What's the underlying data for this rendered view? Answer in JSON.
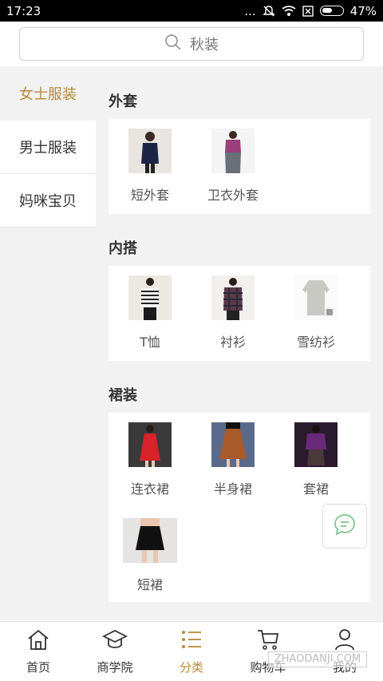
{
  "status_bar": {
    "time": "17:23",
    "dots": "...",
    "battery_pct": "47%"
  },
  "search": {
    "placeholder": "秋装"
  },
  "sidebar": {
    "items": [
      {
        "label": "女士服装",
        "active": true
      },
      {
        "label": "男士服装",
        "active": false
      },
      {
        "label": "妈咪宝贝",
        "active": false
      }
    ]
  },
  "sections": [
    {
      "title": "外套",
      "items": [
        {
          "label": "短外套"
        },
        {
          "label": "卫衣外套"
        }
      ]
    },
    {
      "title": "内搭",
      "items": [
        {
          "label": "T恤"
        },
        {
          "label": "衬衫"
        },
        {
          "label": "雪纺衫"
        }
      ]
    },
    {
      "title": "裙装",
      "items": [
        {
          "label": "连衣裙"
        },
        {
          "label": "半身裙"
        },
        {
          "label": "套裙"
        },
        {
          "label": "短裙"
        }
      ]
    }
  ],
  "tabbar": {
    "items": [
      {
        "label": "首页",
        "icon": "home-icon"
      },
      {
        "label": "商学院",
        "icon": "graduation-cap-icon"
      },
      {
        "label": "分类",
        "icon": "category-list-icon",
        "active": true
      },
      {
        "label": "购物车",
        "icon": "cart-icon"
      },
      {
        "label": "我的",
        "icon": "user-icon"
      }
    ]
  },
  "watermark": "ZHAODANJI.COM",
  "colors": {
    "accent": "#b8893a",
    "background": "#f2f2f2"
  }
}
